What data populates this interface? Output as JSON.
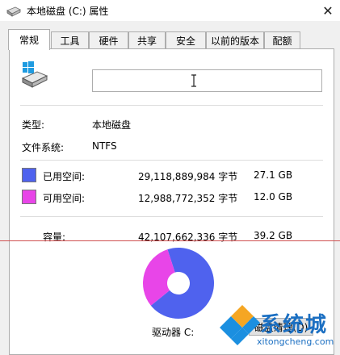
{
  "window": {
    "title": "本地磁盘 (C:) 属性",
    "close_label": "✕"
  },
  "tabs": [
    {
      "label": "常规",
      "active": true
    },
    {
      "label": "工具"
    },
    {
      "label": "硬件"
    },
    {
      "label": "共享"
    },
    {
      "label": "安全"
    },
    {
      "label": "以前的版本"
    },
    {
      "label": "配额"
    }
  ],
  "general": {
    "label_value": "",
    "type_label": "类型:",
    "type_value": "本地磁盘",
    "fs_label": "文件系统:",
    "fs_value": "NTFS",
    "used": {
      "label": "已用空间:",
      "bytes": "29,118,889,984 字节",
      "size": "27.1 GB",
      "color": "#4f62ee"
    },
    "free": {
      "label": "可用空间:",
      "bytes": "12,988,772,352 字节",
      "size": "12.0 GB",
      "color": "#e845e8"
    },
    "capacity": {
      "label": "容量:",
      "bytes": "42,107,662,336 字节",
      "size": "39.2 GB"
    },
    "drive_label": "驱动器 C:",
    "cleanup_button": "磁盘清理(D)"
  },
  "chart_data": {
    "type": "pie",
    "categories": [
      "已用空间",
      "可用空间"
    ],
    "values": [
      29118889984,
      12988772352
    ]
  },
  "watermark": {
    "text": "系统城",
    "url": "xitongcheng.com"
  }
}
